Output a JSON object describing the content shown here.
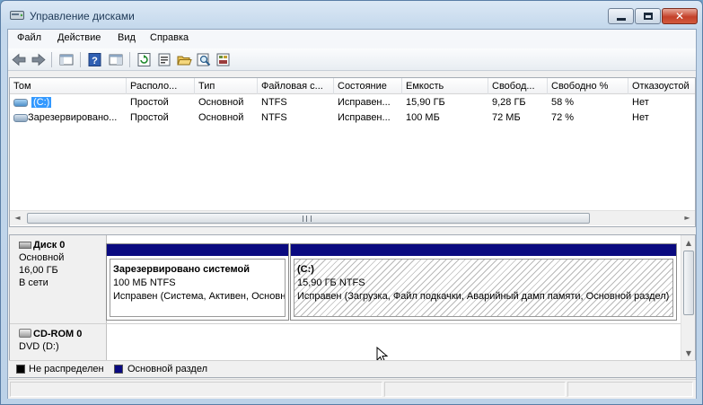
{
  "window": {
    "title": "Управление дисками",
    "min_glyph": "",
    "close_glyph": "✕"
  },
  "menu": {
    "items": [
      "Файл",
      "Действие",
      "Вид",
      "Справка"
    ]
  },
  "toolbar": {
    "icons": [
      "back-arrow-icon",
      "forward-arrow-icon",
      "console-tree-icon",
      "help-icon",
      "properties-view-icon",
      "refresh-icon",
      "properties-icon",
      "open-icon",
      "find-icon",
      "export-icon"
    ]
  },
  "list": {
    "columns": [
      "Том",
      "Располо...",
      "Тип",
      "Файловая с...",
      "Состояние",
      "Емкость",
      "Свобод...",
      "Свободно %",
      "Отказоустой"
    ],
    "rows": [
      [
        "(C:)",
        "Простой",
        "Основной",
        "NTFS",
        "Исправен...",
        "15,90 ГБ",
        "9,28 ГБ",
        "58 %",
        "Нет"
      ],
      [
        "Зарезервировано...",
        "Простой",
        "Основной",
        "NTFS",
        "Исправен...",
        "100 МБ",
        "72 МБ",
        "72 %",
        "Нет"
      ]
    ],
    "scroll_left": "◄",
    "scroll_right": "►"
  },
  "disks": [
    {
      "title": "Диск 0",
      "kind": "Основной",
      "size": "16,00 ГБ",
      "status": "В сети",
      "partitions": [
        {
          "name": "Зарезервировано системой",
          "size": "100 МБ NTFS",
          "status": "Исправен (Система, Активен, Основной раздел)"
        },
        {
          "name": "(C:)",
          "size": "15,90 ГБ NTFS",
          "status": "Исправен (Загрузка, Файл подкачки, Аварийный дамп памяти, Основной раздел)"
        }
      ]
    },
    {
      "title": "CD-ROM 0",
      "kind": "DVD (D:)"
    }
  ],
  "disk_scroll": {
    "up": "▲",
    "down": "▼"
  },
  "legend": [
    {
      "label": "Не распределен",
      "color": "#000000"
    },
    {
      "label": "Основной раздел",
      "color": "#0a0a80"
    }
  ]
}
